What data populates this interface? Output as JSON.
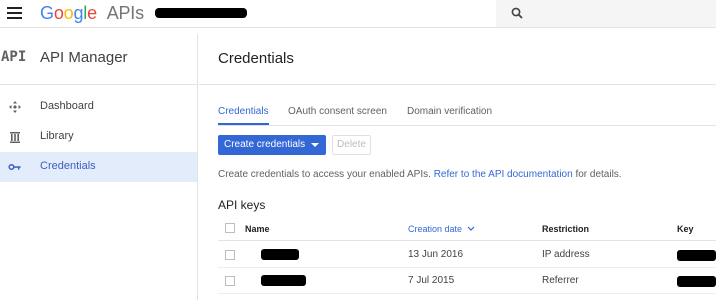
{
  "header": {
    "logo_google": "Google",
    "logo_apis": "APIs",
    "search_placeholder": ""
  },
  "sidebar": {
    "brand_mark": "API",
    "title": "API Manager",
    "items": [
      {
        "label": "Dashboard",
        "icon": "dashboard-icon"
      },
      {
        "label": "Library",
        "icon": "library-icon"
      },
      {
        "label": "Credentials",
        "icon": "key-icon",
        "active": true
      }
    ]
  },
  "main": {
    "title": "Credentials",
    "tabs": [
      {
        "label": "Credentials",
        "active": true
      },
      {
        "label": "OAuth consent screen"
      },
      {
        "label": "Domain verification"
      }
    ],
    "create_button": "Create credentials",
    "delete_button": "Delete",
    "description_prefix": "Create credentials to access your enabled APIs.",
    "description_link": "Refer to the API documentation",
    "description_suffix": "for details.",
    "section_title": "API keys",
    "table": {
      "columns": [
        "Name",
        "Creation date",
        "Restriction",
        "Key"
      ],
      "sorted_column": "Creation date",
      "rows": [
        {
          "creation_date": "13 Jun 2016",
          "restriction": "IP address"
        },
        {
          "creation_date": "7 Jul 2015",
          "restriction": "Referrer"
        }
      ]
    }
  },
  "colors": {
    "accent": "#3367d6",
    "active_nav_bg": "#e3ecfb",
    "google_blue": "#4285f4",
    "google_red": "#ea4335",
    "google_yellow": "#fbbc05",
    "google_green": "#34a853"
  }
}
